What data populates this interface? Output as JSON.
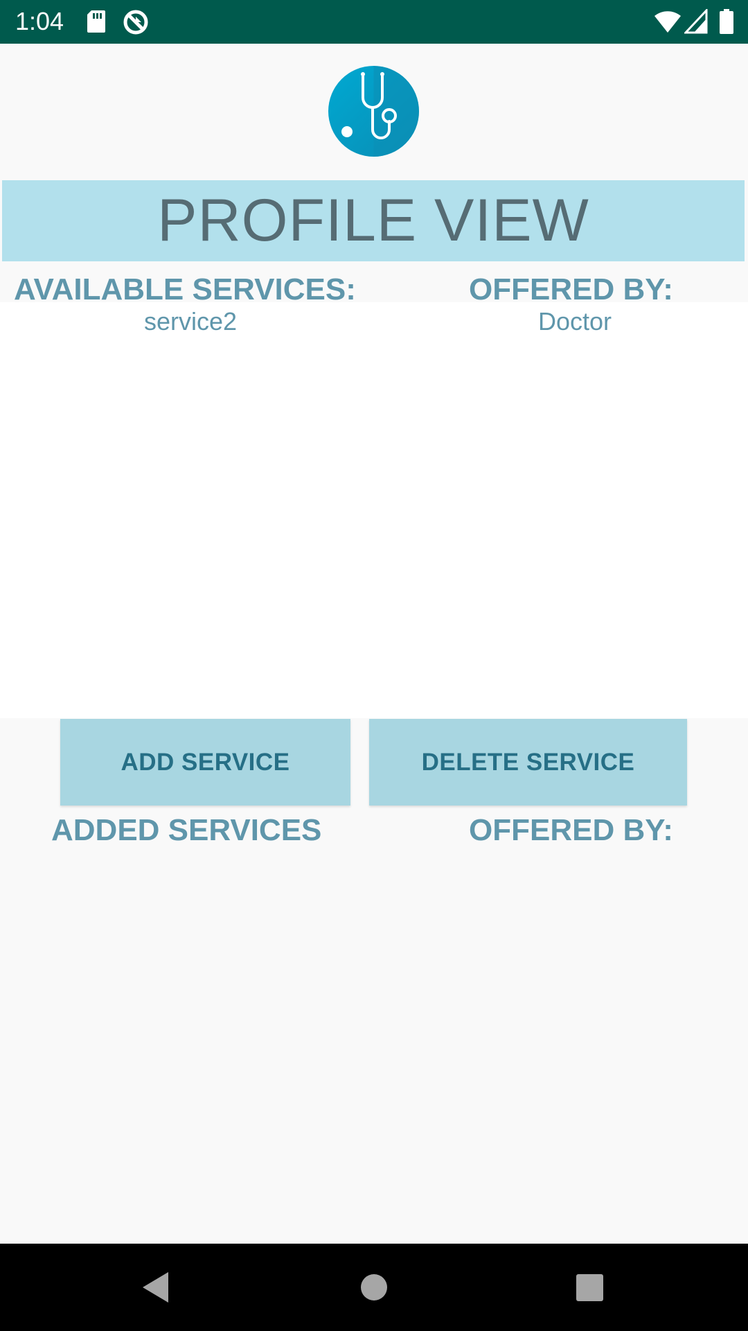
{
  "status_bar": {
    "time": "1:04",
    "icons": [
      "sd-card-icon",
      "sync-icon",
      "wifi-icon",
      "signal-icon",
      "battery-icon"
    ],
    "background": "#005a4d"
  },
  "app": {
    "logo_icon": "stethoscope-icon",
    "title": "PROFILE VIEW",
    "available_header": "AVAILABLE SERVICES:",
    "offered_by_header": "OFFERED BY:",
    "available_services": [
      {
        "service": "service2",
        "offered_by": "Doctor"
      }
    ],
    "add_button": "ADD SERVICE",
    "delete_button": "DELETE SERVICE",
    "added_header": "ADDED SERVICES",
    "added_offered_by_header": "OFFERED BY:",
    "colors": {
      "banner": "#b2e0ec",
      "button": "#a8d6e1",
      "header_text": "#5f96ab",
      "button_text": "#266f86"
    }
  },
  "nav_bar": {
    "buttons": [
      "back-icon",
      "home-icon",
      "recents-icon"
    ]
  }
}
